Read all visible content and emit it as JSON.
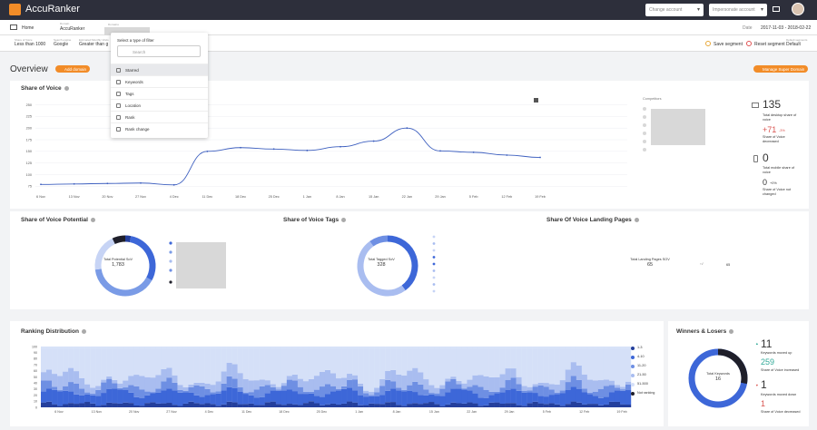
{
  "app": {
    "title": "AccuRanker"
  },
  "topbar": {
    "change_account": "Change account",
    "impersonate": "Impersonate account"
  },
  "subbar": {
    "home": "Home",
    "domain_label": "Domain",
    "domain": "AccuRanker",
    "domains_label": "Domains",
    "date_label": "Date",
    "date": "2017-11-03 - 2018-02-22"
  },
  "segment": {
    "fields": [
      {
        "label": "Share of Voice",
        "value": "Less than 1000"
      },
      {
        "label": "Search engine",
        "value": "Google"
      },
      {
        "label": "Estimated Monthly Visits",
        "value": "Greater than g"
      }
    ],
    "save": "Save segment",
    "reset": "Reset segment",
    "default_label": "Default segments",
    "default": "Default"
  },
  "overview": {
    "title": "Overview",
    "add_domain": "Add domain",
    "manage": "Manage Super Domain"
  },
  "dropdown": {
    "header": "Select a type of filter",
    "placeholder": "Search",
    "items": [
      "Starred",
      "Keywords",
      "Tags",
      "Location",
      "Rank",
      "Rank change"
    ]
  },
  "sov": {
    "title": "Share of Voice",
    "competitors": "Competitors",
    "desktop_value": "135",
    "desktop_label": "Total desktop share of voice",
    "desktop_change": "71",
    "desktop_pct": "-3%",
    "desktop_change_label": "Share of Voice decreased",
    "mobile_value": "0",
    "mobile_label": "Total mobile share of voice",
    "mobile_change": "0",
    "mobile_pct": "+0%",
    "mobile_change_label": "Share of Voice not changed"
  },
  "chart_data": [
    {
      "type": "line",
      "title": "Share of Voice",
      "x": [
        "6 Nov",
        "13 Nov",
        "20 Nov",
        "27 Nov",
        "4 Dec",
        "11 Dec",
        "18 Dec",
        "25 Dec",
        "1 Jan",
        "8 Jan",
        "15 Jan",
        "22 Jan",
        "29 Jan",
        "5 Feb",
        "12 Feb",
        "19 Feb"
      ],
      "yticks": [
        75,
        100,
        125,
        150,
        175,
        200,
        225,
        250
      ],
      "ylim": [
        62,
        255
      ],
      "series": [
        {
          "values": [
            79,
            80,
            81,
            82,
            78,
            150,
            158,
            155,
            152,
            160,
            172,
            200,
            151,
            148,
            142,
            137
          ]
        }
      ],
      "color": "#3d5fbf"
    },
    {
      "type": "bar",
      "title": "Ranking Distribution",
      "x": [
        "6 Nov",
        "13 Nov",
        "20 Nov",
        "27 Nov",
        "4 Dec",
        "11 Dec",
        "18 Dec",
        "25 Dec",
        "1 Jan",
        "8 Jan",
        "15 Jan",
        "22 Jan",
        "29 Jan",
        "5 Feb",
        "12 Feb",
        "19 Feb"
      ],
      "yticks": [
        0,
        10,
        20,
        30,
        40,
        50,
        60,
        70,
        80,
        90,
        100
      ],
      "ylim": [
        0,
        100
      ],
      "series": [
        {
          "name": "1-3",
          "color": "#243f9c"
        },
        {
          "name": "4-10",
          "color": "#3d67d8"
        },
        {
          "name": "11-20",
          "color": "#6e8fe3"
        },
        {
          "name": "21-50",
          "color": "#a9bdf0"
        },
        {
          "name": "51-500",
          "color": "#d5e0f8"
        },
        {
          "name": "Not ranking",
          "color": "#1f1f2a"
        }
      ]
    }
  ],
  "potential": {
    "title": "Share of Voice Potential",
    "label": "Total Potential SoV",
    "value": "1,783"
  },
  "tags": {
    "title": "Share of Voice Tags",
    "label": "Total Tagged SoV",
    "value": "328"
  },
  "landing": {
    "title": "Share Of Voice Landing Pages",
    "label": "Total Landing Pages SOV",
    "value": "65",
    "legend_label": "/",
    "legend_value": "65"
  },
  "ranking": {
    "title": "Ranking Distribution",
    "legend": [
      "1-3",
      "4-10",
      "11-20",
      "21-50",
      "51-500",
      "Not ranking"
    ]
  },
  "winners": {
    "title": "Winners & Losers",
    "label": "Total Keywords",
    "value": "16",
    "up": "11",
    "up_label": "Keywords moved up",
    "up_sov": "259",
    "up_sov_label": "Share of Voice increased",
    "down": "1",
    "down_label": "Keywords moved down",
    "down_sov": "1",
    "down_sov_label": "Share of Voice decreased"
  }
}
